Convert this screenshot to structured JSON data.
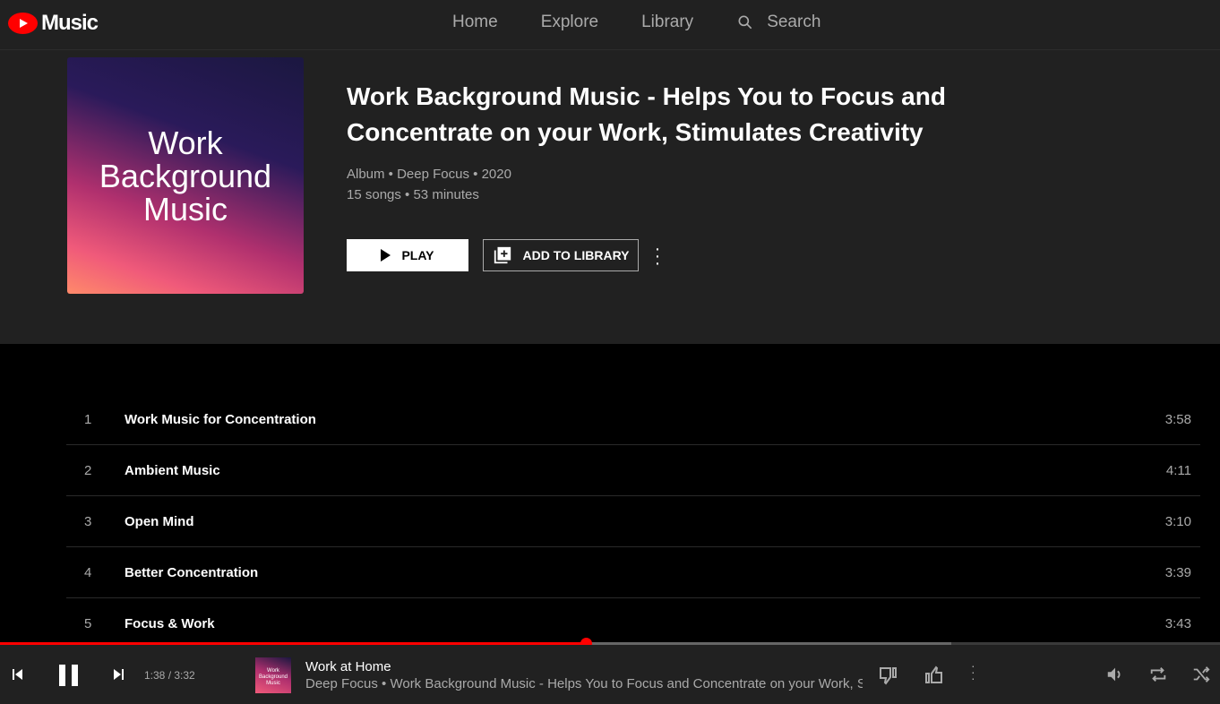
{
  "nav": {
    "logo": "Music",
    "links": [
      "Home",
      "Explore",
      "Library"
    ],
    "search_label": "Search"
  },
  "album": {
    "art_text": "Work Background Music",
    "title": "Work Background Music - Helps You to Focus and Concentrate on your Work, Stimulates Creativity",
    "meta1": "Album • Deep Focus • 2020",
    "meta2": "15 songs • 53 minutes",
    "play_label": "PLAY",
    "add_label": "ADD TO LIBRARY"
  },
  "tracks": [
    {
      "num": "1",
      "title": "Work Music for Concentration",
      "duration": "3:58"
    },
    {
      "num": "2",
      "title": "Ambient Music",
      "duration": "4:11"
    },
    {
      "num": "3",
      "title": "Open Mind",
      "duration": "3:10"
    },
    {
      "num": "4",
      "title": "Better Concentration",
      "duration": "3:39"
    },
    {
      "num": "5",
      "title": "Focus & Work",
      "duration": "3:43"
    }
  ],
  "player": {
    "time": "1:38 / 3:32",
    "progress_percent": 48,
    "buffered_percent": 78,
    "thumb_text": "Work Background Music",
    "song": "Work at Home",
    "subtitle": "Deep Focus • Work Background Music - Helps You to Focus and Concentrate on your Work, Stimulates Creativity"
  },
  "colors": {
    "accent": "#ff0000",
    "background": "#000000",
    "header": "#212121"
  }
}
